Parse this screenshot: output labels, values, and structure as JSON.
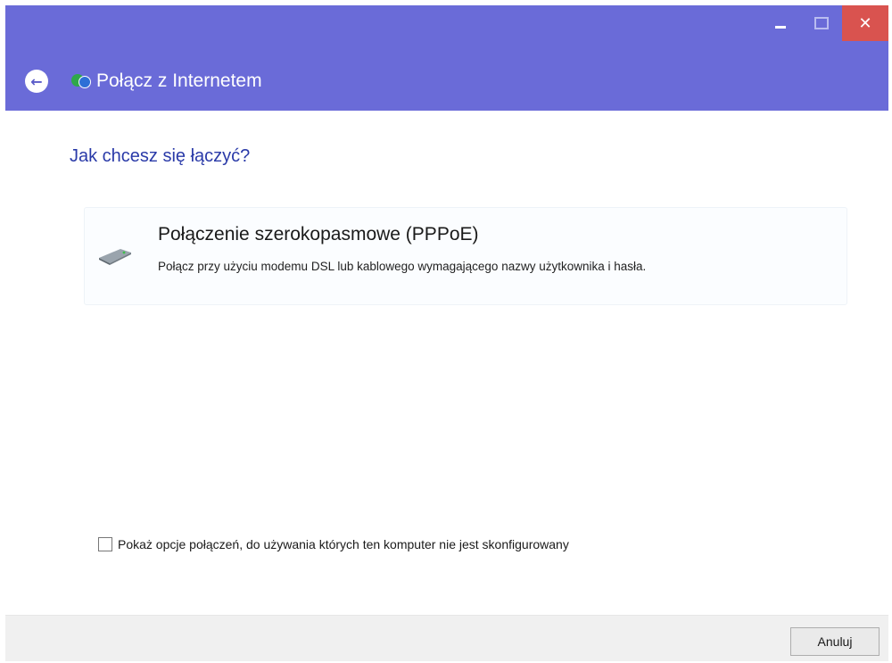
{
  "window": {
    "title": "Połącz z Internetem",
    "controls": {
      "minimize": "–",
      "maximize": "□",
      "close": "✕"
    }
  },
  "main": {
    "heading": "Jak chcesz się łączyć?",
    "option": {
      "title": "Połączenie szerokopasmowe (PPPoE)",
      "description": "Połącz przy użyciu modemu DSL lub kablowego wymagającego nazwy użytkownika i hasła.",
      "icon": "modem-icon"
    },
    "show_options_checkbox": {
      "label": "Pokaż opcje połączeń, do używania których ten komputer nie jest skonfigurowany",
      "checked": false
    }
  },
  "footer": {
    "cancel_label": "Anuluj"
  },
  "colors": {
    "titlebar": "#6a6bd8",
    "heading": "#2a3aa8",
    "close_button": "#d9534f"
  }
}
